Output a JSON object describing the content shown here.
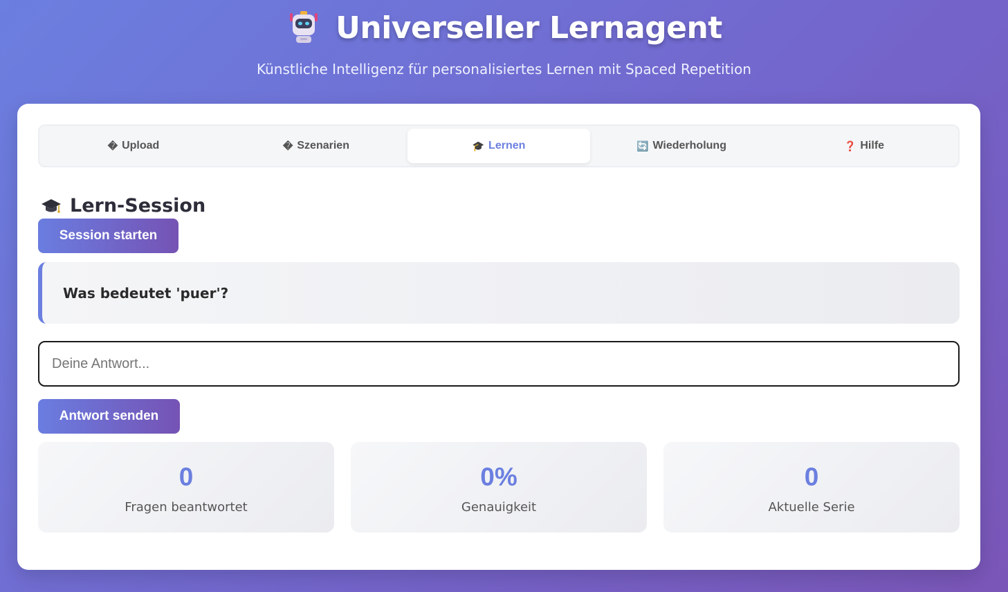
{
  "header": {
    "icon": "robot-icon",
    "title": "Universeller Lernagent",
    "subtitle": "Künstliche Intelligenz für personalisiertes Lernen mit Spaced Repetition"
  },
  "tabs": [
    {
      "icon": "�",
      "label": "Upload"
    },
    {
      "icon": "�",
      "label": "Szenarien"
    },
    {
      "icon": "🎓",
      "label": "Lernen",
      "active": true
    },
    {
      "icon": "🔄",
      "label": "Wiederholung"
    },
    {
      "icon": "❓",
      "label": "Hilfe"
    }
  ],
  "section": {
    "icon": "graduation-cap-icon",
    "title": "Lern-Session"
  },
  "session_button": "Session starten",
  "question": "Was bedeutet 'puer'?",
  "answer": {
    "value": "",
    "placeholder": "Deine Antwort..."
  },
  "send_button": "Antwort senden",
  "stats": [
    {
      "value": "0",
      "label": "Fragen beantwortet"
    },
    {
      "value": "0%",
      "label": "Genauigkeit"
    },
    {
      "value": "0",
      "label": "Aktuelle Serie"
    }
  ],
  "colors": {
    "accent": "#6b7fe0",
    "gradient_start": "#6b7fe0",
    "gradient_end": "#7a56b8"
  }
}
